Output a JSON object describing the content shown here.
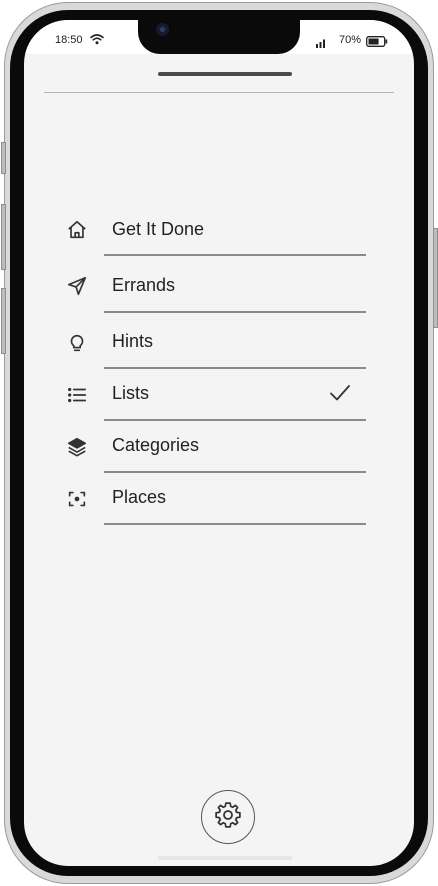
{
  "status_bar": {
    "time": "18:50",
    "battery_percent_text": "70%",
    "battery_level": 0.7,
    "wifi_icon": "wifi-icon",
    "signal_icon": "cellular-signal-icon",
    "battery_icon": "battery-icon"
  },
  "menu": {
    "items": [
      {
        "label": "Get It Done",
        "icon": "home-icon",
        "selected": false
      },
      {
        "label": "Errands",
        "icon": "send-icon",
        "selected": false
      },
      {
        "label": "Hints",
        "icon": "lightbulb-icon",
        "selected": false
      },
      {
        "label": "Lists",
        "icon": "list-icon",
        "selected": true
      },
      {
        "label": "Categories",
        "icon": "layers-icon",
        "selected": false
      },
      {
        "label": "Places",
        "icon": "focus-target-icon",
        "selected": false
      }
    ],
    "selected_indicator_icon": "checkmark-icon"
  },
  "footer": {
    "settings_icon": "gear-icon"
  },
  "colors": {
    "screen_background": "#f4f4f4",
    "text": "#222222",
    "divider": "#8a8a8a",
    "icon": "#333333"
  }
}
